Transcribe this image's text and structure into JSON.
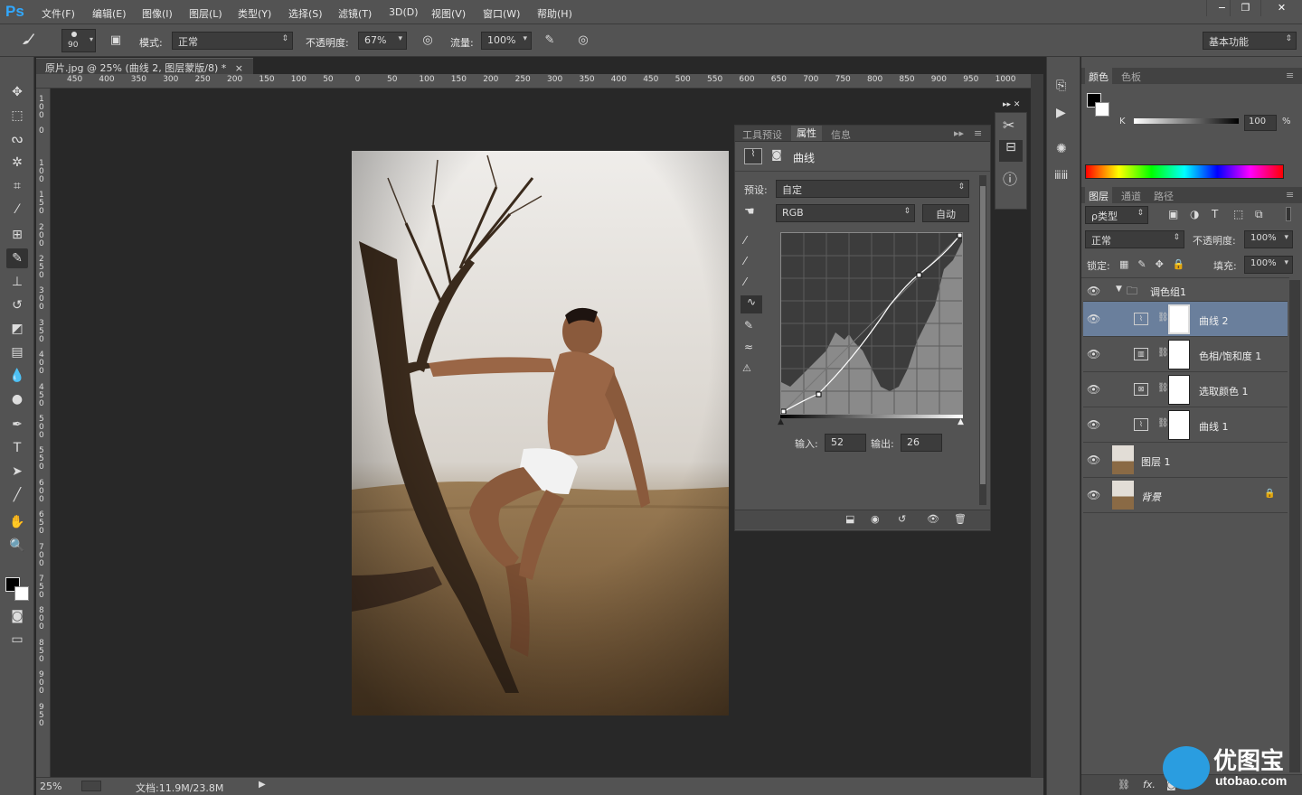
{
  "app": {
    "logo": "Ps"
  },
  "menu": [
    "文件(F)",
    "编辑(E)",
    "图像(I)",
    "图层(L)",
    "类型(Y)",
    "选择(S)",
    "滤镜(T)",
    "3D(D)",
    "视图(V)",
    "窗口(W)",
    "帮助(H)"
  ],
  "window_controls": {
    "minimize": "−",
    "restore": "❐",
    "close": "✕"
  },
  "options": {
    "brush_size": "90",
    "mode_label": "模式:",
    "mode_value": "正常",
    "opacity_label": "不透明度:",
    "opacity_value": "67%",
    "flow_label": "流量:",
    "flow_value": "100%",
    "workspace": "基本功能"
  },
  "document": {
    "tab_title": "原片.jpg @ 25% (曲线 2, 图层蒙版/8) *",
    "ruler_h": [
      "450",
      "400",
      "350",
      "300",
      "250",
      "200",
      "150",
      "100",
      "50",
      "0",
      "50",
      "100",
      "150",
      "200",
      "250",
      "300",
      "350",
      "400",
      "450",
      "500",
      "550",
      "600",
      "650",
      "700",
      "750",
      "800",
      "850",
      "900",
      "950",
      "1000"
    ],
    "ruler_v": [
      "1\n0\n0",
      "0",
      "1\n0\n0",
      "1\n5\n0",
      "2\n0\n0",
      "2\n5\n0",
      "3\n0\n0",
      "3\n5\n0",
      "4\n0\n0",
      "4\n5\n0",
      "5\n0\n0",
      "5\n5\n0",
      "6\n0\n0",
      "6\n5\n0",
      "7\n0\n0",
      "7\n5\n0",
      "8\n0\n0",
      "8\n5\n0",
      "9\n0\n0",
      "9\n5\n0"
    ]
  },
  "status": {
    "zoom": "25%",
    "doc_size": "文档:11.9M/23.8M"
  },
  "properties": {
    "tabs": [
      "工具预设",
      "属性",
      "信息"
    ],
    "active_tab": "属性",
    "title": "曲线",
    "preset_label": "预设:",
    "preset_value": "自定",
    "channel": "RGB",
    "auto_button": "自动",
    "input_label": "输入:",
    "input_value": "52",
    "output_label": "输出:",
    "output_value": "26"
  },
  "color_panel": {
    "tabs": [
      "颜色",
      "色板"
    ],
    "k_label": "K",
    "k_value": "100",
    "percent": "%"
  },
  "layers_panel": {
    "tabs": [
      "图层",
      "通道",
      "路径"
    ],
    "filter": "ρ类型",
    "blend_mode": "正常",
    "opacity_label": "不透明度:",
    "opacity_value": "100%",
    "lock_label": "锁定:",
    "fill_label": "填充:",
    "fill_value": "100%",
    "group_name": "调色组1",
    "layers": [
      {
        "name": "曲线 2",
        "type": "curves",
        "selected": true
      },
      {
        "name": "色相/饱和度 1",
        "type": "hue",
        "selected": false
      },
      {
        "name": "选取颜色 1",
        "type": "selective",
        "selected": false
      },
      {
        "name": "曲线 1",
        "type": "curves",
        "selected": false
      },
      {
        "name": "图层 1",
        "type": "pixel",
        "selected": false
      },
      {
        "name": "背景",
        "type": "background",
        "selected": false
      }
    ]
  },
  "watermark": {
    "text": "优图宝",
    "url": "utobao.com"
  }
}
